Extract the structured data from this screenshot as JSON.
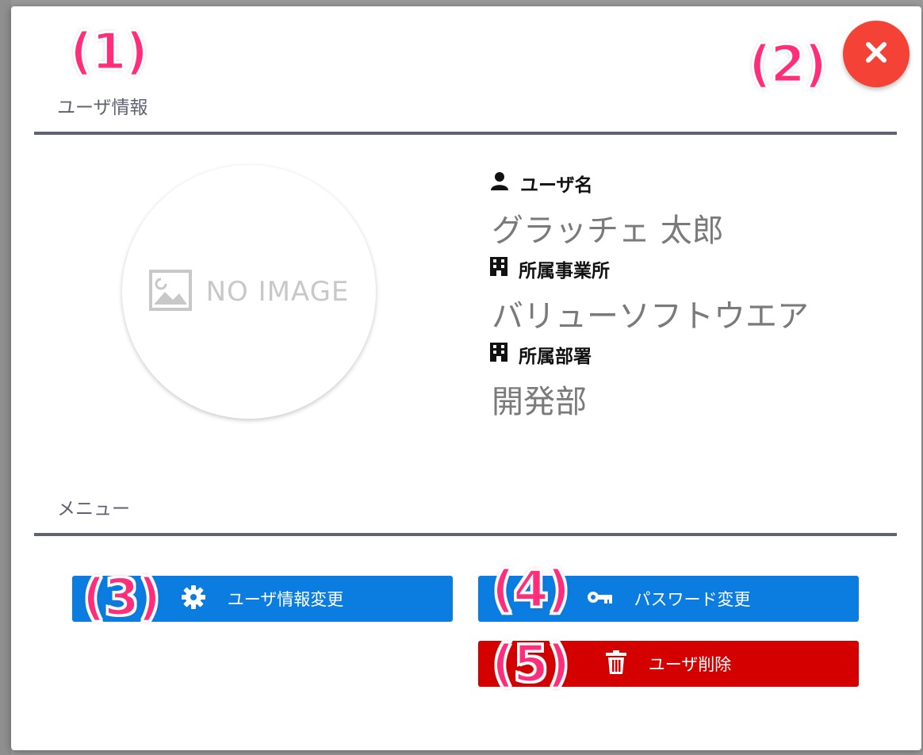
{
  "annotations": [
    "(1)",
    "(2)",
    "(3)",
    "(4)",
    "(5)"
  ],
  "profile": {
    "section_title": "ユーザ情報",
    "avatar_placeholder": "NO IMAGE",
    "fields": [
      {
        "label": "ユーザ名",
        "value": "グラッチェ 太郎",
        "icon": "user-icon"
      },
      {
        "label": "所属事業所",
        "value": "バリューソフトウエア",
        "icon": "building-icon"
      },
      {
        "label": "所属部署",
        "value": "開発部",
        "icon": "building-icon"
      }
    ]
  },
  "menu": {
    "section_title": "メニュー",
    "buttons": [
      {
        "label": "ユーザ情報変更",
        "icon": "gear-icon",
        "color": "#0b7de1"
      },
      {
        "label": "パスワード変更",
        "icon": "key-icon",
        "color": "#0b7de1"
      },
      {
        "label": "ユーザ削除",
        "icon": "trash-icon",
        "color": "#d40000"
      }
    ]
  },
  "colors": {
    "close": "#f44336",
    "primary": "#0b7de1",
    "danger": "#d40000",
    "annotation": "#ff2d7a",
    "rule": "#5f6272"
  },
  "close_icon": "close-icon"
}
